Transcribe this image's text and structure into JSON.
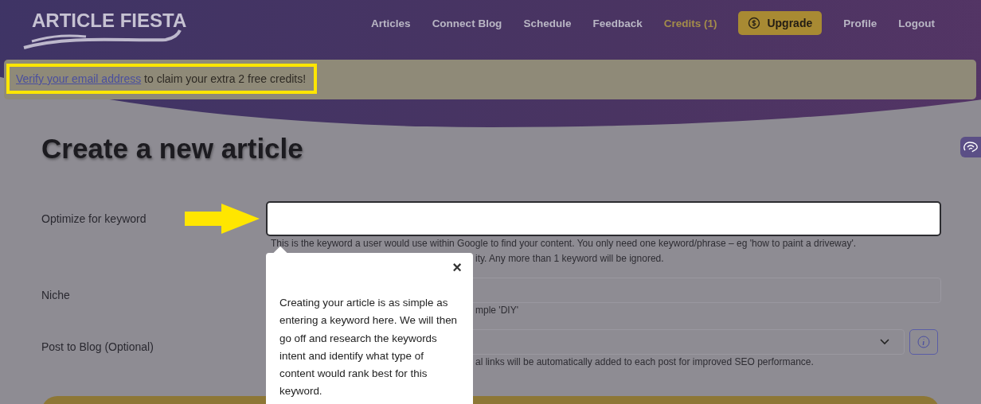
{
  "logo": {
    "text": "ARTICLE FIESTA"
  },
  "nav": [
    {
      "label": "Articles",
      "kind": "link"
    },
    {
      "label": "Connect Blog",
      "kind": "link"
    },
    {
      "label": "Schedule",
      "kind": "link"
    },
    {
      "label": "Feedback",
      "kind": "link"
    },
    {
      "label": "Credits (1)",
      "kind": "credits"
    },
    {
      "label": "Upgrade",
      "kind": "button"
    },
    {
      "label": "Profile",
      "kind": "link"
    },
    {
      "label": "Logout",
      "kind": "link"
    }
  ],
  "banner": {
    "link": "Verify your email address",
    "text": " to claim your extra 2 free credits!"
  },
  "title": "Create a new article",
  "form": [
    {
      "label": "Optimize for keyword",
      "kind": "text",
      "highlighted": true,
      "help": [
        {
          "text": "This is the keyword a user would use within Google to find your content. You only need one keyword/phrase – eg 'how to paint a driveway'.",
          "partly_hidden": false
        },
        {
          "text": "ity. Any more than 1 keyword will be ignored.",
          "partly_hidden": true
        }
      ]
    },
    {
      "label": "Niche",
      "kind": "text",
      "highlighted": false,
      "help": [
        {
          "text": "mple 'DIY'",
          "partly_hidden": true
        }
      ]
    },
    {
      "label": "Post to Blog (Optional)",
      "kind": "select",
      "highlighted": false,
      "help": [
        {
          "text": "al links will be automatically added to each post for improved SEO performance.",
          "partly_hidden": true
        }
      ]
    }
  ],
  "popover": {
    "text": "Creating your article is as simple as entering a keyword here. We will then go off and research the keywords intent and identify what type of content would rank best for this keyword.",
    "close": "×"
  }
}
